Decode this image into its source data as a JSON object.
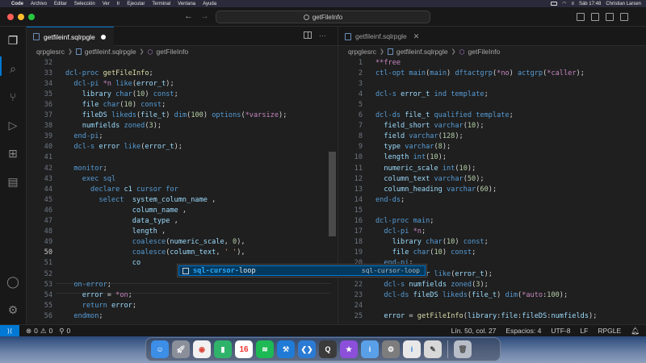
{
  "menubar": {
    "app": "Code",
    "items": [
      "Archivo",
      "Editar",
      "Selección",
      "Ver",
      "Ir",
      "Ejecutar",
      "Terminal",
      "Ventana",
      "Ayuda"
    ],
    "clock": "Sáb 17:48",
    "user": "Christian Larsen"
  },
  "titlebar": {
    "command_center": "getFileInfo"
  },
  "left_editor": {
    "tab_label": "getfileinf.sqlrpgle",
    "breadcrumb": [
      "qrpglesrc",
      "getfileinf.sqlrpgle",
      "getFileInfo"
    ]
  },
  "right_editor": {
    "tab_label": "getfileinf.sqlrpgle",
    "breadcrumb": [
      "qrpglesrc",
      "getfileinf.sqlrpgle",
      "getFileInfo"
    ]
  },
  "left_code": [
    {
      "n": "32",
      "t": ""
    },
    {
      "n": "33",
      "t": "dcl-proc getFileInfo;"
    },
    {
      "n": "34",
      "t": "  dcl-pi *n like(error_t);"
    },
    {
      "n": "35",
      "t": "    library char(10) const;"
    },
    {
      "n": "36",
      "t": "    file char(10) const;"
    },
    {
      "n": "37",
      "t": "    fileDS likeds(file_t) dim(100) options(*varsize);"
    },
    {
      "n": "38",
      "t": "    numfields zoned(3);"
    },
    {
      "n": "39",
      "t": "  end-pi;"
    },
    {
      "n": "40",
      "t": "  dcl-s error like(error_t);"
    },
    {
      "n": "41",
      "t": ""
    },
    {
      "n": "42",
      "t": "  monitor;"
    },
    {
      "n": "43",
      "t": "    exec sql"
    },
    {
      "n": "44",
      "t": "      declare c1 cursor for"
    },
    {
      "n": "45",
      "t": "        select  system_column_name ,"
    },
    {
      "n": "46",
      "t": "                column_name ,"
    },
    {
      "n": "47",
      "t": "                data_type ,"
    },
    {
      "n": "48",
      "t": "                length ,"
    },
    {
      "n": "49",
      "t": "                coalesce(numeric_scale, 0),"
    },
    {
      "n": "50",
      "t": "                coalesce(column_text, ' '),"
    },
    {
      "n": "51",
      "t": "                co"
    },
    {
      "n": "52",
      "t": ""
    },
    {
      "n": "53",
      "t": "  on-error;"
    },
    {
      "n": "54",
      "t": "    error = *on;"
    },
    {
      "n": "55",
      "t": "    return error;"
    },
    {
      "n": "56",
      "t": "  endmon;"
    }
  ],
  "right_code": [
    {
      "n": "1",
      "t": "**free"
    },
    {
      "n": "2",
      "t": "ctl-opt main(main) dftactgrp(*no) actgrp(*caller);"
    },
    {
      "n": "3",
      "t": ""
    },
    {
      "n": "4",
      "t": "dcl-s error_t ind template;"
    },
    {
      "n": "5",
      "t": ""
    },
    {
      "n": "6",
      "t": "dcl-ds file_t qualified template;"
    },
    {
      "n": "7",
      "t": "  field_short varchar(10);"
    },
    {
      "n": "8",
      "t": "  field varchar(128);"
    },
    {
      "n": "9",
      "t": "  type varchar(8);"
    },
    {
      "n": "10",
      "t": "  length int(10);"
    },
    {
      "n": "11",
      "t": "  numeric_scale int(10);"
    },
    {
      "n": "12",
      "t": "  column_text varchar(50);"
    },
    {
      "n": "13",
      "t": "  column_heading varchar(60);"
    },
    {
      "n": "14",
      "t": "end-ds;"
    },
    {
      "n": "15",
      "t": ""
    },
    {
      "n": "16",
      "t": "dcl-proc main;"
    },
    {
      "n": "17",
      "t": "  dcl-pi *n;"
    },
    {
      "n": "18",
      "t": "    library char(10) const;"
    },
    {
      "n": "19",
      "t": "    file char(10) const;"
    },
    {
      "n": "20",
      "t": "  end-pi;"
    },
    {
      "n": "21",
      "t": "  dcl-s error like(error_t);"
    },
    {
      "n": "22",
      "t": "  dcl-s numfields zoned(3);"
    },
    {
      "n": "23",
      "t": "  dcl-ds fileDS likeds(file_t) dim(*auto:100);"
    },
    {
      "n": "24",
      "t": ""
    },
    {
      "n": "25",
      "t": "  error = getFileInfo(library:file:fileDS:numfields);"
    }
  ],
  "suggest": {
    "label_hi": "sql-cursor-",
    "label_rest": "loop",
    "detail": "sql-cursor-loop"
  },
  "statusbar": {
    "problems_errors": "0",
    "problems_warnings": "0",
    "ports": "0",
    "position": "Lín. 50, col. 27",
    "spaces": "Espacios: 4",
    "encoding": "UTF-8",
    "eol": "LF",
    "language": "RPGLE"
  },
  "dock": {
    "calendar_day": "16"
  },
  "colors": {
    "accent": "#0078d4",
    "keyword": "#569cd6",
    "function": "#dcdcaa",
    "identifier": "#9cdcfe"
  }
}
